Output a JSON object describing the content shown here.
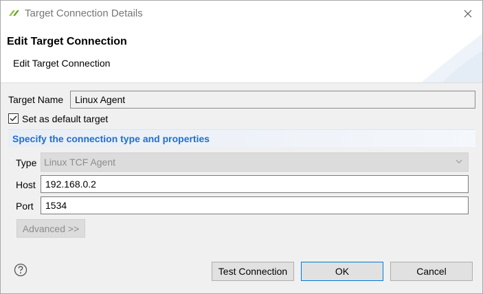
{
  "window": {
    "title": "Target Connection Details",
    "close_icon": "close-icon"
  },
  "banner": {
    "title": "Edit Target Connection",
    "subtitle": "Edit Target Connection"
  },
  "form": {
    "target_name_label": "Target Name",
    "target_name_value": "Linux Agent",
    "default_checkbox_label": "Set as default target",
    "default_checked": true,
    "group_title": "Specify the connection type and properties",
    "type_label": "Type",
    "type_value": "Linux TCF Agent",
    "host_label": "Host",
    "host_value": "192.168.0.2",
    "port_label": "Port",
    "port_value": "1534",
    "advanced_label": "Advanced >>"
  },
  "footer": {
    "help_icon": "help-icon",
    "test_connection_label": "Test Connection",
    "ok_label": "OK",
    "cancel_label": "Cancel"
  },
  "colors": {
    "accent": "#1f6fcf",
    "default_button_border": "#0078d7"
  }
}
